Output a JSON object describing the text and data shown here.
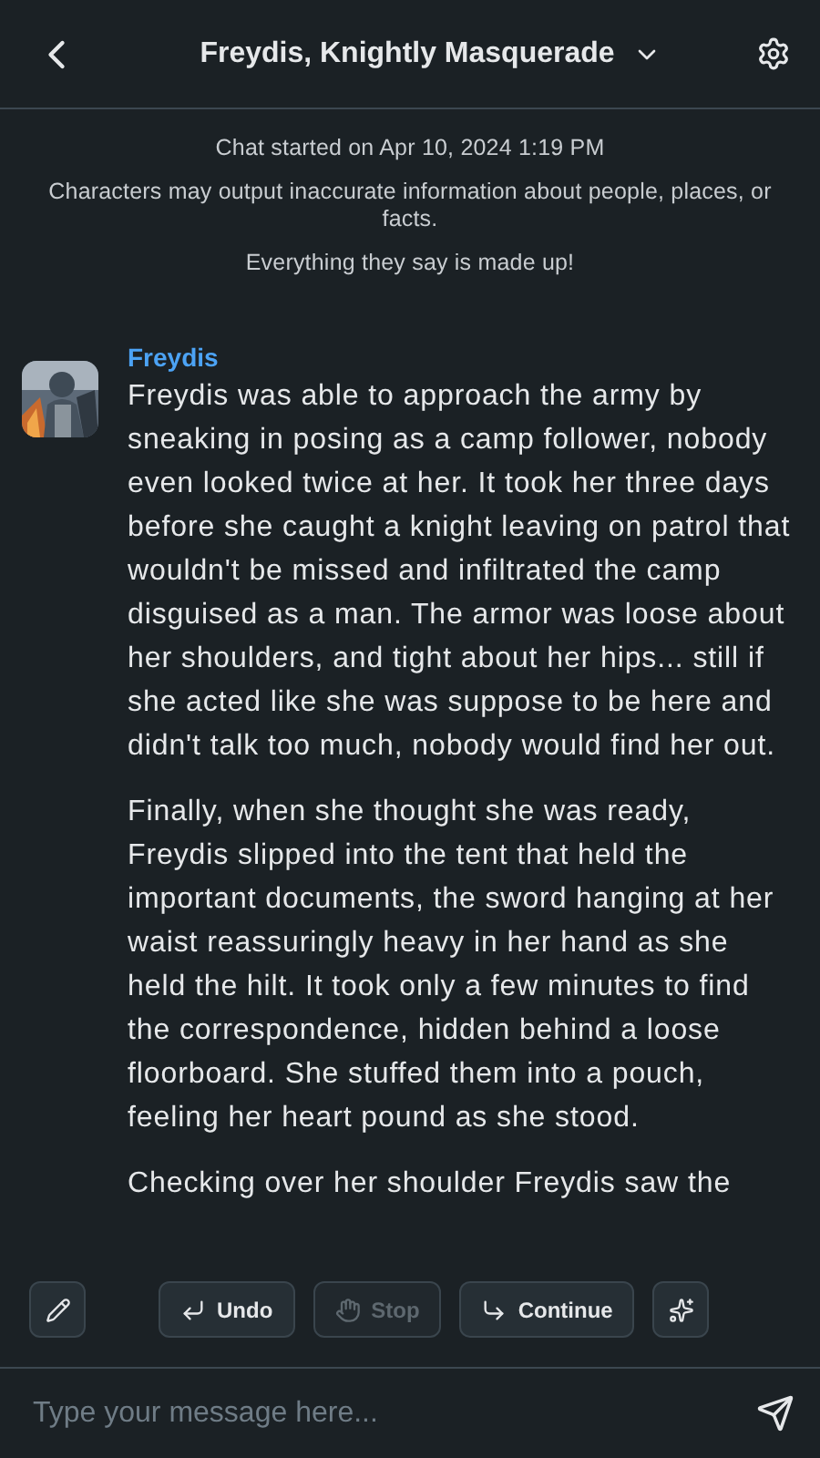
{
  "header": {
    "title": "Freydis, Knightly Masquerade"
  },
  "notice": {
    "started": "Chat started on Apr 10, 2024 1:19 PM",
    "warning": "Characters may output inaccurate information about people, places, or facts.",
    "made_up": "Everything they say is made up!"
  },
  "messages": [
    {
      "author": "Freydis",
      "paragraphs": [
        "Freydis was able to approach the army by sneaking in posing as a camp follower, nobody even looked twice at her. It took her three days before she caught a knight leaving on patrol that wouldn't be missed and infiltrated the camp disguised as a man. The armor was loose about her shoulders, and tight about her hips... still if she acted like she was suppose to be here and didn't talk too much, nobody would find her out.",
        "Finally, when she thought she was ready, Freydis slipped into the tent that held the important documents, the sword hanging at her waist reassuringly heavy in her hand as she held the hilt. It took only a few minutes to find the correspondence, hidden behind a loose floorboard. She stuffed them into a pouch, feeling her heart pound as she stood.",
        "Checking over her shoulder Freydis saw the"
      ]
    }
  ],
  "actions": [
    {
      "kind": "edit",
      "disabled": false
    },
    {
      "kind": "undo",
      "label": "Undo",
      "disabled": false
    },
    {
      "kind": "stop",
      "label": "Stop",
      "disabled": true
    },
    {
      "kind": "continue",
      "label": "Continue",
      "disabled": false
    },
    {
      "kind": "magic",
      "disabled": false
    }
  ],
  "composer": {
    "placeholder": "Type your message here..."
  }
}
